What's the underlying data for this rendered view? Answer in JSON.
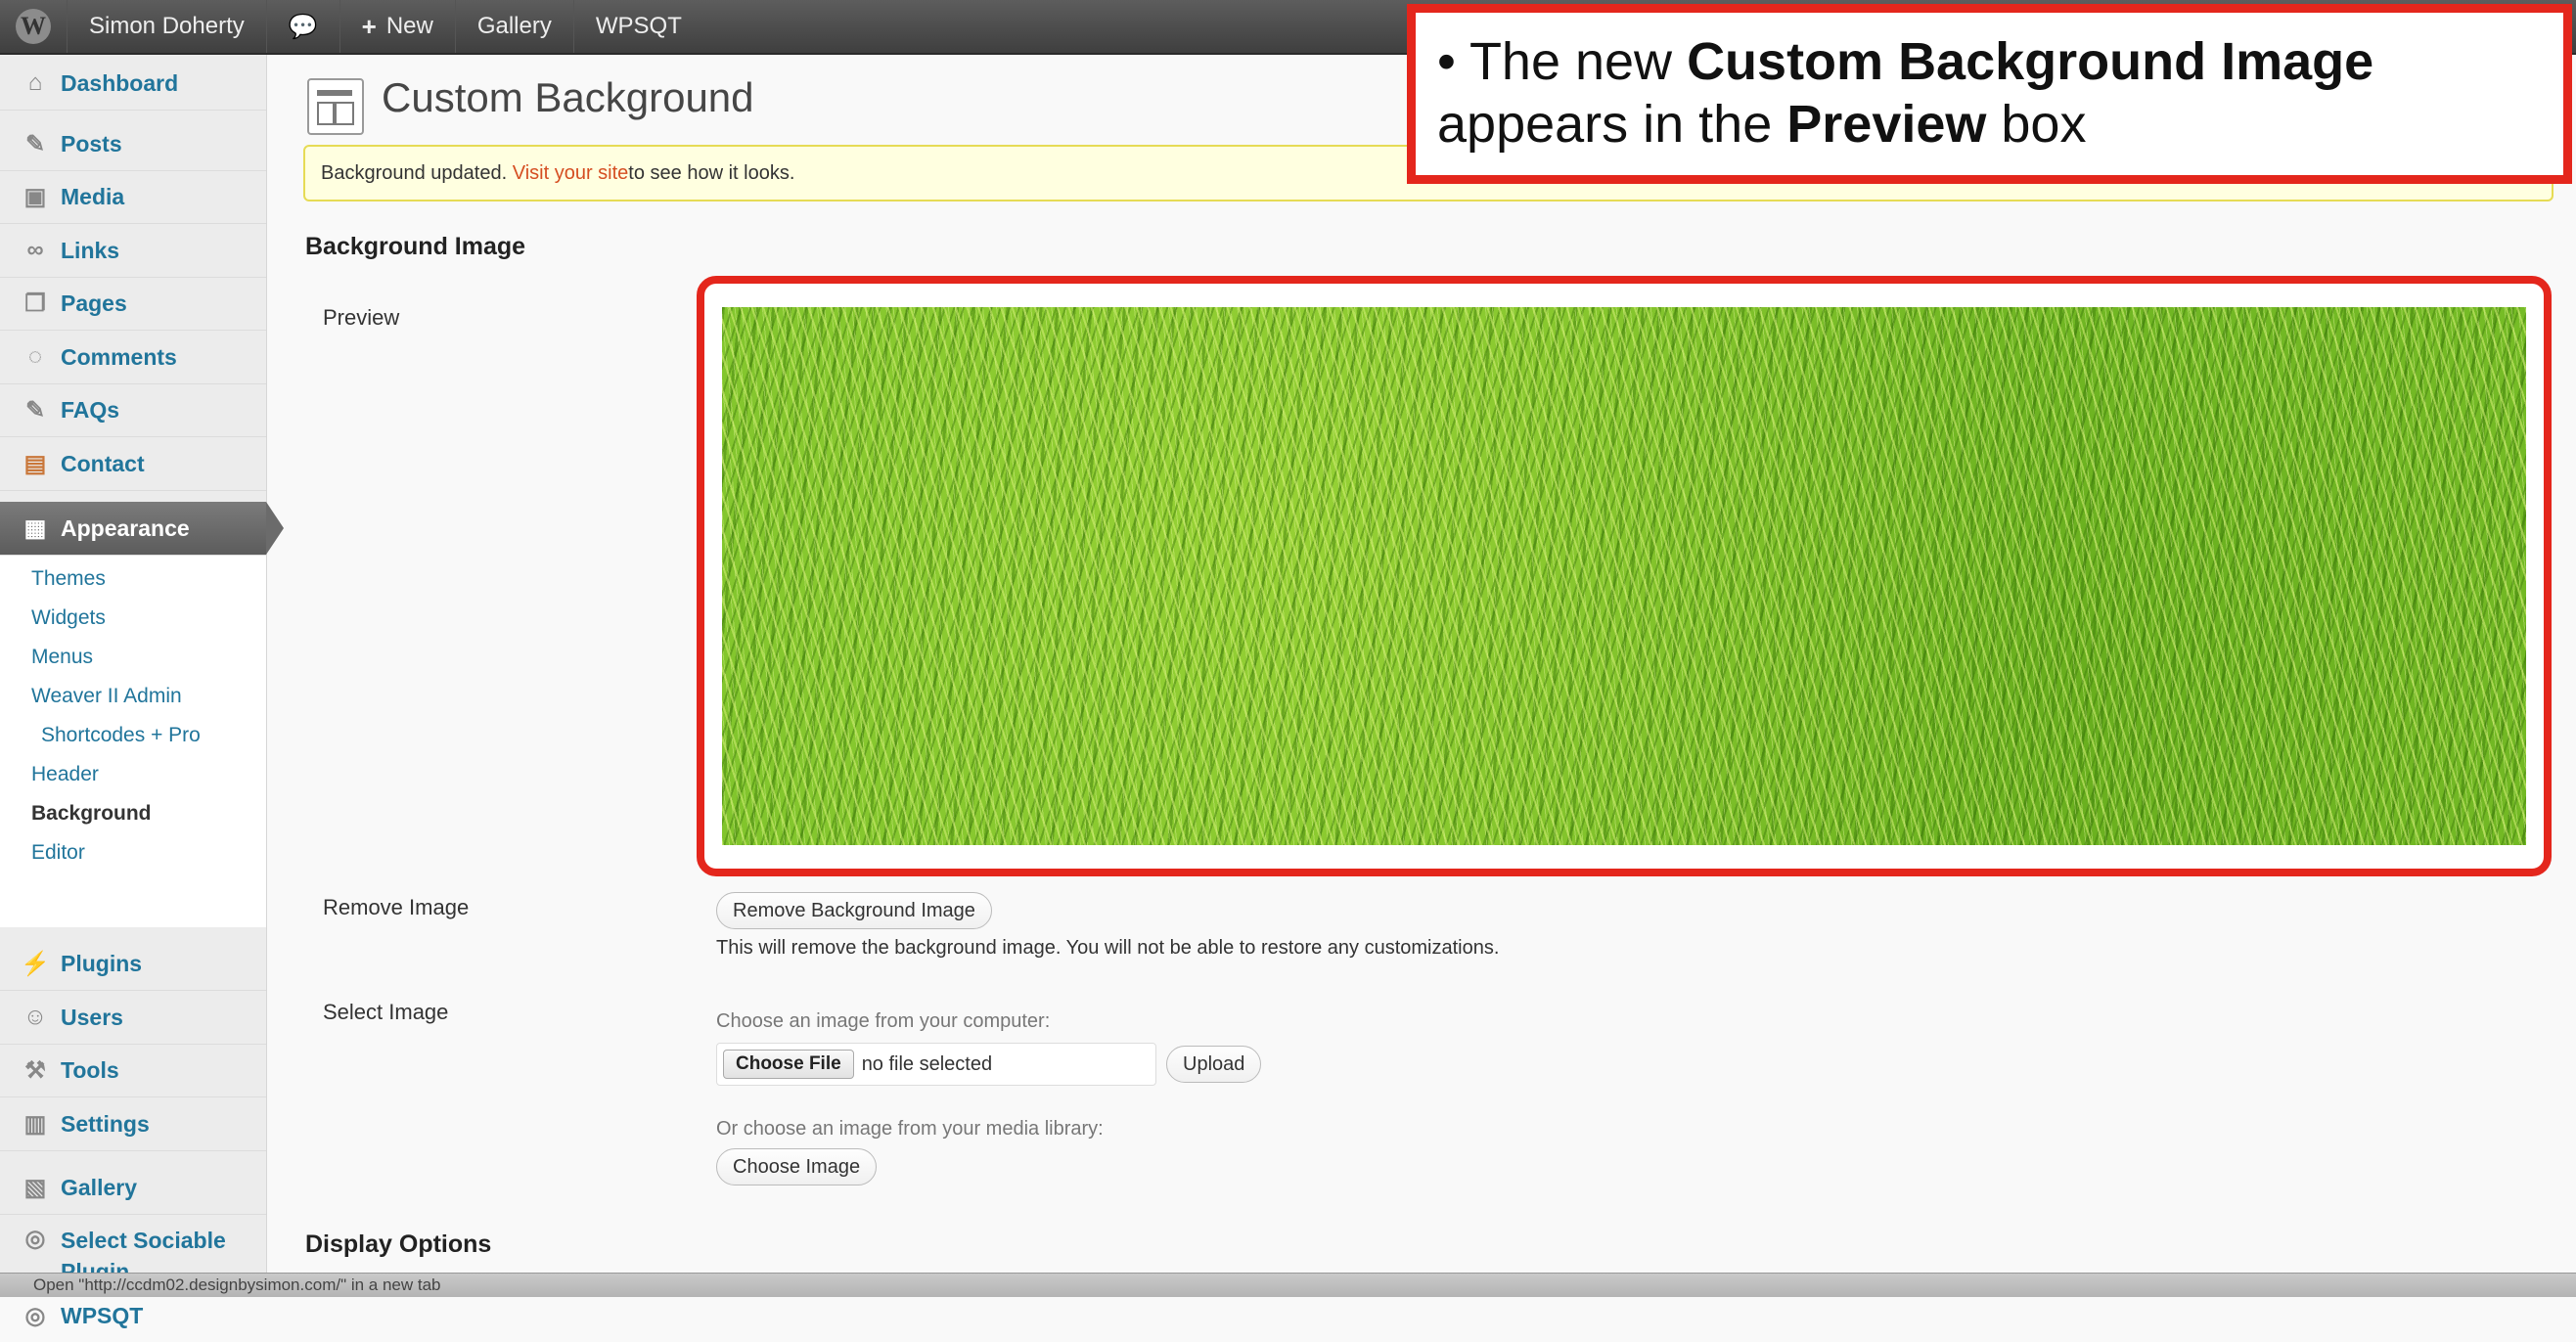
{
  "admin_bar": {
    "site_name": "Simon Doherty",
    "new_label": "New",
    "gallery_label": "Gallery",
    "wpsqt_label": "WPSQT"
  },
  "sidebar": {
    "items": [
      {
        "label": "Dashboard",
        "icon": "house-icon"
      },
      {
        "label": "Posts",
        "icon": "pushpin-icon"
      },
      {
        "label": "Media",
        "icon": "media-icon"
      },
      {
        "label": "Links",
        "icon": "link-icon"
      },
      {
        "label": "Pages",
        "icon": "pages-icon"
      },
      {
        "label": "Comments",
        "icon": "comment-icon"
      },
      {
        "label": "FAQs",
        "icon": "pushpin-icon"
      },
      {
        "label": "Contact",
        "icon": "contact-icon"
      },
      {
        "label": "Appearance",
        "icon": "appearance-icon"
      },
      {
        "label": "Plugins",
        "icon": "plugin-icon"
      },
      {
        "label": "Users",
        "icon": "users-icon"
      },
      {
        "label": "Tools",
        "icon": "tools-icon"
      },
      {
        "label": "Settings",
        "icon": "settings-icon"
      },
      {
        "label": "Gallery",
        "icon": "gallery-icon"
      },
      {
        "label": "Select Sociable Plugin",
        "icon": "sociable-icon"
      },
      {
        "label": "WPSQT",
        "icon": "wpsqt-icon"
      }
    ],
    "appearance_sub": [
      "Themes",
      "Widgets",
      "Menus",
      "Weaver II Admin",
      "Shortcodes + Pro",
      "Header",
      "Background",
      "Editor"
    ]
  },
  "page": {
    "title": "Custom Background",
    "notice_before": "Background updated. ",
    "notice_link": "Visit your site",
    "notice_after": " to see how it looks.",
    "section_background_image": "Background Image",
    "preview_label": "Preview",
    "remove_image_label": "Remove Image",
    "remove_button": "Remove Background Image",
    "remove_help": "This will remove the background image. You will not be able to restore any customizations.",
    "select_image_label": "Select Image",
    "choose_from_computer": "Choose an image from your computer:",
    "choose_file_button": "Choose File",
    "no_file_selected": "no file selected",
    "upload_button": "Upload",
    "choose_from_library": "Or choose an image from your media library:",
    "choose_image_button": "Choose Image",
    "section_display_options": "Display Options"
  },
  "status_bar": {
    "text": "Open \"http://ccdm02.designbysimon.com/\" in a new tab"
  },
  "callout": {
    "bullet": "•",
    "t1": "The new ",
    "t2": "Custom Background Image",
    "t3": "appears in the ",
    "t4": "Preview",
    "t5": " box"
  },
  "colors": {
    "callout_border": "#e4261c",
    "link": "#21759b",
    "notice_link": "#d54e21",
    "grass": "#7bc12a"
  }
}
